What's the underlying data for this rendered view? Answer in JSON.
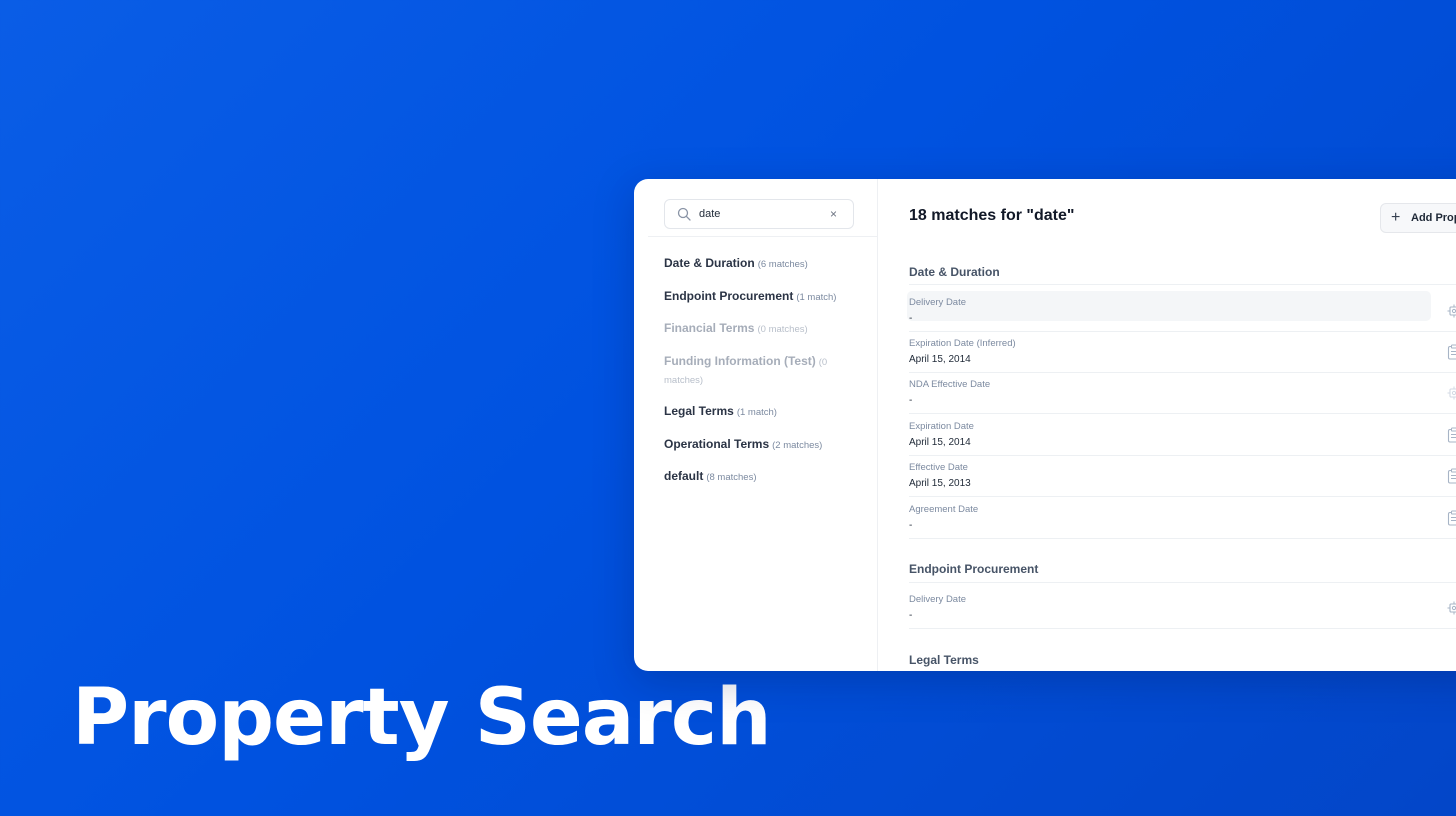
{
  "hero": {
    "title": "Property Search"
  },
  "search": {
    "value": "date",
    "clear": "×"
  },
  "categories": [
    {
      "name": "Date & Duration",
      "count": "(6 matches)"
    },
    {
      "name": "Endpoint Procurement",
      "count": "(1 match)"
    },
    {
      "name": "Financial Terms",
      "count": "(0 matches)"
    },
    {
      "name": "Funding Information (Test)",
      "count": "(0 matches)"
    },
    {
      "name": "Legal Terms",
      "count": "(1 match)"
    },
    {
      "name": "Operational Terms",
      "count": "(2 matches)"
    },
    {
      "name": "default",
      "count": "(8 matches)"
    }
  ],
  "results": {
    "title": "18 matches for \"date\"",
    "add_button": "Add Property",
    "add_icon": "+"
  },
  "sections": {
    "date_duration": {
      "title": "Date & Duration",
      "rows": [
        {
          "label": "Delivery Date",
          "value": "-"
        },
        {
          "label": "Expiration Date (Inferred)",
          "value": "April 15, 2014"
        },
        {
          "label": "NDA Effective Date",
          "value": "-"
        },
        {
          "label": "Expiration Date",
          "value": "April 15, 2014"
        },
        {
          "label": "Effective Date",
          "value": "April 15, 2013"
        },
        {
          "label": "Agreement Date",
          "value": "-"
        }
      ]
    },
    "endpoint": {
      "title": "Endpoint Procurement",
      "rows": [
        {
          "label": "Delivery Date",
          "value": "-"
        }
      ]
    },
    "legal": {
      "title": "Legal Terms"
    }
  },
  "colors": {
    "background": "#0052e0",
    "card": "#ffffff",
    "accent_icon": "#9fb0c6"
  },
  "icons": [
    "search-icon",
    "close-icon",
    "plus-icon",
    "gear-icon",
    "clipboard-icon"
  ]
}
